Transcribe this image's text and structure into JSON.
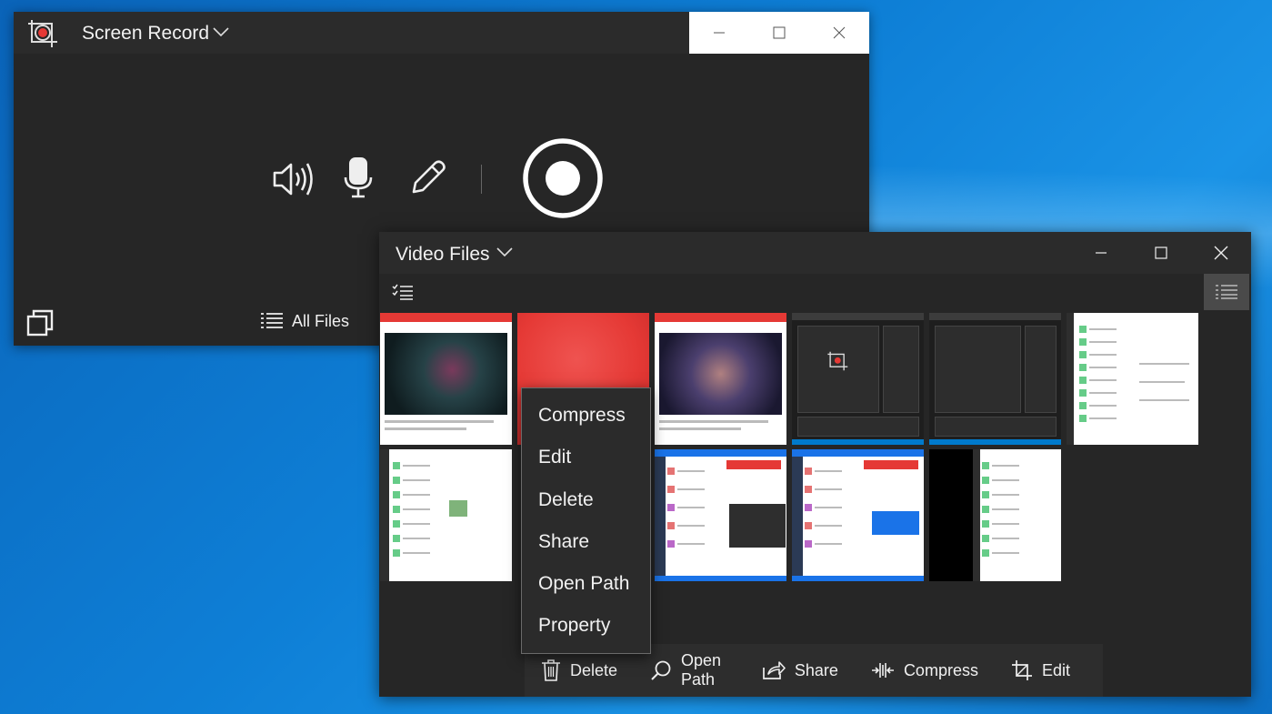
{
  "colors": {
    "accent_red": "#e53935",
    "window_bg": "#262626",
    "titlebar_bg": "#2b2b2b"
  },
  "screen_record": {
    "title": "Screen Record",
    "icons": [
      "crop-record-icon",
      "chevron-down-icon",
      "minimize-icon",
      "maximize-icon",
      "close-icon",
      "speaker-icon",
      "microphone-icon",
      "pen-icon",
      "record-icon",
      "restore-window-icon",
      "list-icon"
    ],
    "all_files_label": "All Files"
  },
  "video_files": {
    "title": "Video Files",
    "thumbnails": [
      {
        "kind": "video-player"
      },
      {
        "kind": "red-splash"
      },
      {
        "kind": "video-player"
      },
      {
        "kind": "code-editor"
      },
      {
        "kind": "code-editor"
      },
      {
        "kind": "chat-app"
      },
      {
        "kind": "chat-app"
      },
      {
        "kind": "chat-app"
      },
      {
        "kind": "web-app"
      },
      {
        "kind": "web-app"
      },
      {
        "kind": "chat-app"
      }
    ],
    "commands": {
      "delete": "Delete",
      "open_path": "Open Path",
      "share": "Share",
      "compress": "Compress",
      "edit": "Edit"
    }
  },
  "context_menu": {
    "items": [
      "Compress",
      "Edit",
      "Delete",
      "Share",
      "Open Path",
      "Property"
    ]
  }
}
